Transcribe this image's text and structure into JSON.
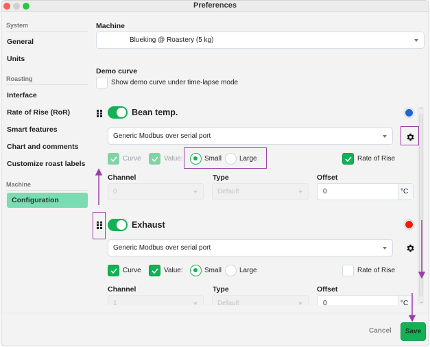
{
  "window": {
    "title": "Preferences"
  },
  "sidebar": {
    "sections": [
      {
        "label": "System",
        "items": [
          {
            "label": "General"
          },
          {
            "label": "Units"
          }
        ]
      },
      {
        "label": "Roasting",
        "items": [
          {
            "label": "Interface"
          },
          {
            "label": "Rate of Rise (RoR)"
          },
          {
            "label": "Smart features"
          },
          {
            "label": "Chart and comments"
          },
          {
            "label": "Customize roast labels"
          }
        ]
      },
      {
        "label": "Machine",
        "items": [
          {
            "label": "Configuration",
            "active": true
          }
        ]
      }
    ]
  },
  "main": {
    "machine": {
      "label": "Machine",
      "selected": "Blueking  @ Roastery (5 kg)"
    },
    "demo_curve": {
      "label": "Demo curve",
      "checkbox_label": "Show demo curve under time-lapse mode",
      "checked": false
    },
    "sensors": [
      {
        "name": "Bean temp.",
        "enabled": true,
        "color": "#1e64d6",
        "source": "Generic Modbus over serial port",
        "curve_label": "Curve",
        "curve": true,
        "value_label": "Value:",
        "value": true,
        "size_options": [
          "Small",
          "Large"
        ],
        "size": "Small",
        "ror_label": "Rate of Rise",
        "ror": true,
        "channel_label": "Channel",
        "channel": "0",
        "type_label": "Type",
        "type": "Default",
        "offset_label": "Offset",
        "offset": "0",
        "offset_unit": "°C"
      },
      {
        "name": "Exhaust",
        "enabled": true,
        "color": "#f01c0c",
        "source": "Generic Modbus over serial port",
        "curve_label": "Curve",
        "curve": true,
        "value_label": "Value:",
        "value": true,
        "size_options": [
          "Small",
          "Large"
        ],
        "size": "Small",
        "ror_label": "Rate of Rise",
        "ror": false,
        "channel_label": "Channel",
        "channel": "1",
        "type_label": "Type",
        "type": "Default",
        "offset_label": "Offset",
        "offset": "0",
        "offset_unit": "°C"
      }
    ]
  },
  "footer": {
    "cancel_label": "Cancel",
    "save_label": "Save"
  },
  "colors": {
    "accent": "#12b254",
    "active_nav": "#7bdbb2",
    "annotation": "#9b3fa7"
  }
}
